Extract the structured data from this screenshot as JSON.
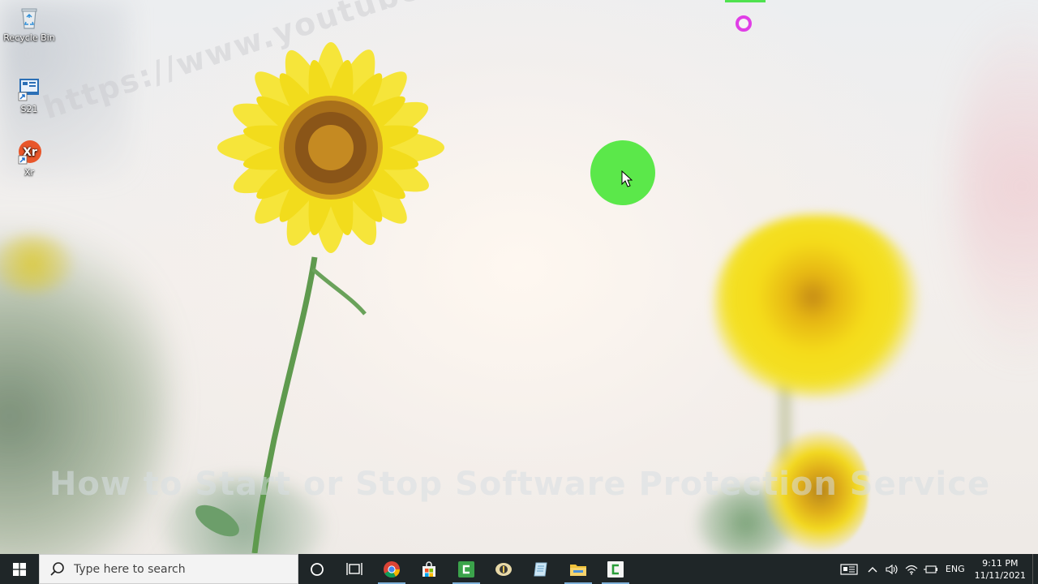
{
  "desktop": {
    "icons": [
      {
        "label": "Recycle Bin",
        "icon": "recycle-bin-icon"
      },
      {
        "label": "S21",
        "icon": "shortcut-s21-icon"
      },
      {
        "label": "Xr",
        "icon": "xr-app-icon"
      }
    ],
    "watermark_url": "https://www.youtube.com",
    "title_overlay": "How to Start or Stop Software Protection Service"
  },
  "taskbar": {
    "search_placeholder": "Type here to search",
    "pinned": [
      {
        "name": "cortana",
        "icon": "cortana-circle-icon"
      },
      {
        "name": "task-view",
        "icon": "task-view-icon"
      },
      {
        "name": "chrome",
        "icon": "chrome-icon"
      },
      {
        "name": "microsoft-store",
        "icon": "store-bag-icon"
      },
      {
        "name": "camtasia",
        "icon": "camtasia-icon"
      },
      {
        "name": "audio-app",
        "icon": "audio-app-icon"
      },
      {
        "name": "notepad-app",
        "icon": "notepad-icon"
      },
      {
        "name": "file-explorer",
        "icon": "folder-icon"
      },
      {
        "name": "camtasia-recorder",
        "icon": "camtasia-recorder-icon"
      }
    ],
    "tray": {
      "language": "ENG",
      "time": "9:11 PM",
      "date": "11/11/2021"
    }
  },
  "colors": {
    "taskbar_bg": "#1f2628",
    "cursor_halo": "#5be84a",
    "click_ring": "#e03ee6",
    "active_underline": "#7fb1d9"
  }
}
